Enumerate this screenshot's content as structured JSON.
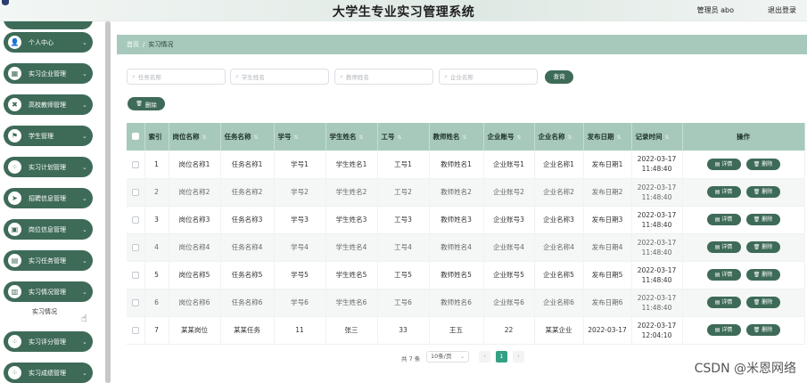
{
  "header": {
    "title": "大学生专业实习管理系统",
    "user_label": "管理员 abo",
    "logout_label": "退出登录"
  },
  "sidebar": {
    "items": [
      {
        "label": "个人中心",
        "icon": "user-icon",
        "glyph": "👤"
      },
      {
        "label": "实习企业管理",
        "icon": "grid-icon",
        "glyph": "▦"
      },
      {
        "label": "高校教师管理",
        "icon": "cross-icon",
        "glyph": "✖"
      },
      {
        "label": "学生管理",
        "icon": "flag-icon",
        "glyph": "⚑"
      },
      {
        "label": "实习计划管理",
        "icon": "apps-icon",
        "glyph": "⁘"
      },
      {
        "label": "招聘信息管理",
        "icon": "send-icon",
        "glyph": "➤"
      },
      {
        "label": "岗位信息管理",
        "icon": "image-icon",
        "glyph": "▣"
      },
      {
        "label": "实习任务管理",
        "icon": "briefcase-icon",
        "glyph": "▤"
      },
      {
        "label": "实习情况管理",
        "icon": "bar-chart-icon",
        "glyph": "▥"
      },
      {
        "label": "实习评分管理",
        "icon": "apps-icon",
        "glyph": "⁘"
      },
      {
        "label": "实习成绩管理",
        "icon": "apps-icon",
        "glyph": "⁘"
      }
    ],
    "active_submenu": "实习情况"
  },
  "breadcrumb": {
    "home": "首页",
    "separator": "/",
    "current": "实习情况"
  },
  "search": {
    "placeholders": [
      "任务名称",
      "学生姓名",
      "教师姓名",
      "企业名称"
    ],
    "query_label": "查询"
  },
  "actions": {
    "delete_label": "删除"
  },
  "table": {
    "columns": [
      "索引",
      "岗位名称",
      "任务名称",
      "学号",
      "学生姓名",
      "工号",
      "教师姓名",
      "企业账号",
      "企业名称",
      "发布日期",
      "记录时间",
      "操作"
    ],
    "detail_label": "详情",
    "delete_label": "删除",
    "rows": [
      [
        "1",
        "岗位名称1",
        "任务名称1",
        "学号1",
        "学生姓名1",
        "工号1",
        "教师姓名1",
        "企业账号1",
        "企业名称1",
        "发布日期1",
        "2022-03-17",
        "11:48:40"
      ],
      [
        "2",
        "岗位名称2",
        "任务名称2",
        "学号2",
        "学生姓名2",
        "工号2",
        "教师姓名2",
        "企业账号2",
        "企业名称2",
        "发布日期2",
        "2022-03-17",
        "11:48:40"
      ],
      [
        "3",
        "岗位名称3",
        "任务名称3",
        "学号3",
        "学生姓名3",
        "工号3",
        "教师姓名3",
        "企业账号3",
        "企业名称3",
        "发布日期3",
        "2022-03-17",
        "11:48:40"
      ],
      [
        "4",
        "岗位名称4",
        "任务名称4",
        "学号4",
        "学生姓名4",
        "工号4",
        "教师姓名4",
        "企业账号4",
        "企业名称4",
        "发布日期4",
        "2022-03-17",
        "11:48:40"
      ],
      [
        "5",
        "岗位名称5",
        "任务名称5",
        "学号5",
        "学生姓名5",
        "工号5",
        "教师姓名5",
        "企业账号5",
        "企业名称5",
        "发布日期5",
        "2022-03-17",
        "11:48:40"
      ],
      [
        "6",
        "岗位名称6",
        "任务名称6",
        "学号6",
        "学生姓名6",
        "工号6",
        "教师姓名6",
        "企业账号6",
        "企业名称6",
        "发布日期6",
        "2022-03-17",
        "11:48:40"
      ],
      [
        "7",
        "某某岗位",
        "某某任务",
        "11",
        "张三",
        "33",
        "王五",
        "22",
        "某某企业",
        "2022-03-17",
        "2022-03-17",
        "12:04:10"
      ]
    ]
  },
  "pagination": {
    "total_label": "共 7 条",
    "page_size_label": "10条/页",
    "current_page": "1",
    "prev": "‹",
    "next": "›"
  },
  "watermark": "CSDN @米恩网络",
  "colors": {
    "primary": "#3e6b58",
    "header_bg": "#a7c9bc",
    "page_active": "#35a084"
  }
}
